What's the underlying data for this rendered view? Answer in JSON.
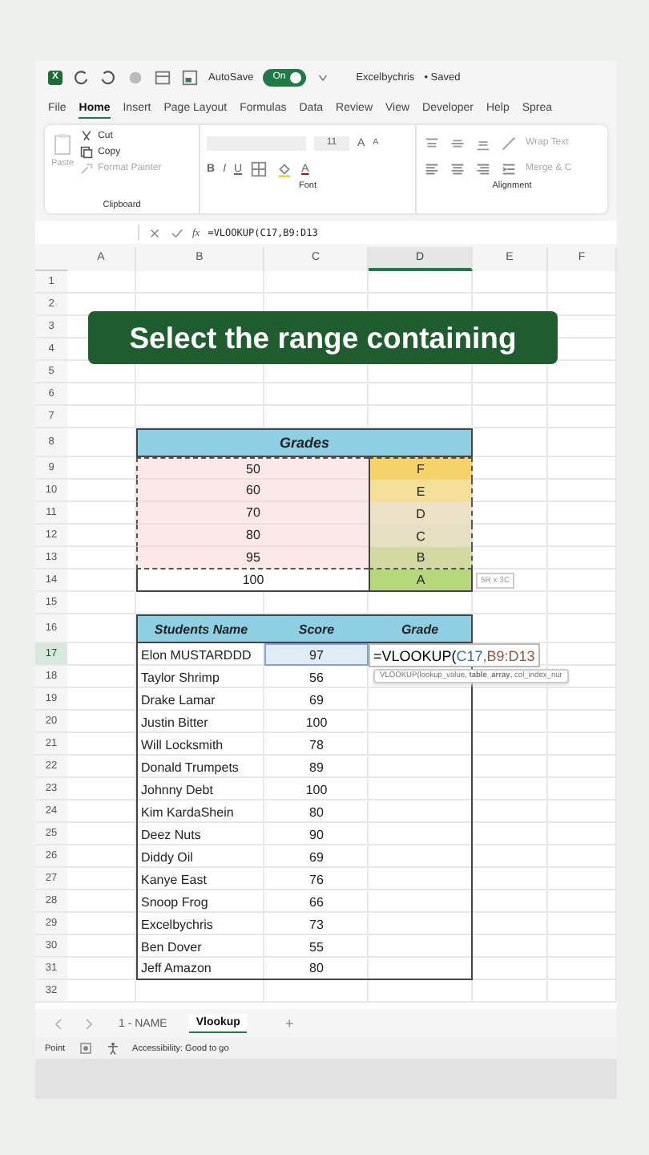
{
  "title_bar": {
    "logo_letter": "X",
    "autosave_label": "AutoSave",
    "autosave_on": true,
    "autosave_state": "On",
    "file_name": "Excelbychris",
    "save_status": "• Saved"
  },
  "menu_tabs": [
    {
      "label": "File",
      "selected": false
    },
    {
      "label": "Home",
      "selected": true
    },
    {
      "label": "Insert",
      "selected": false
    },
    {
      "label": "Page Layout",
      "selected": false
    },
    {
      "label": "Formulas",
      "selected": false
    },
    {
      "label": "Data",
      "selected": false
    },
    {
      "label": "Review",
      "selected": false
    },
    {
      "label": "View",
      "selected": false
    },
    {
      "label": "Developer",
      "selected": false
    },
    {
      "label": "Help",
      "selected": false
    },
    {
      "label": "Sprea",
      "selected": false
    }
  ],
  "ribbon": {
    "clipboard": {
      "paste": "Paste",
      "cut": "Cut",
      "copy": "Copy",
      "format_painter": "Format Painter",
      "group": "Clipboard"
    },
    "font": {
      "size": "11",
      "grow": "A",
      "shrink": "A",
      "bold": "B",
      "italic": "I",
      "underline": "U",
      "font_color_button": "A",
      "group": "Font"
    },
    "alignment": {
      "wrap_text": "Wrap Text",
      "merge": "Merge & C",
      "group": "Alignment"
    }
  },
  "formula_bar": {
    "fx": "fx",
    "formula": "=VLOOKUP(C17,B9:D13"
  },
  "columns": [
    {
      "label": "A",
      "selected": false
    },
    {
      "label": "B",
      "selected": false
    },
    {
      "label": "C",
      "selected": false
    },
    {
      "label": "D",
      "selected": true
    },
    {
      "label": "E",
      "selected": false
    },
    {
      "label": "F",
      "selected": false
    }
  ],
  "banner": "Select the range containing",
  "rows": [
    {
      "number": "1",
      "selected": false,
      "cells": []
    },
    {
      "number": "2",
      "selected": false,
      "cells": []
    },
    {
      "number": "3",
      "selected": false,
      "cells": []
    },
    {
      "number": "4",
      "selected": false,
      "cells": []
    },
    {
      "number": "5",
      "selected": false,
      "cells": []
    },
    {
      "number": "6",
      "selected": false,
      "cells": []
    },
    {
      "number": "7",
      "selected": false,
      "cells": []
    },
    {
      "number": "8",
      "selected": false,
      "cells": [
        {
          "kind": "title",
          "text": "Grades"
        }
      ]
    },
    {
      "number": "9",
      "selected": false,
      "cells": [
        {
          "kind": "range-score",
          "text": "50",
          "in_range": true
        },
        {
          "kind": "grade",
          "text": "F",
          "color": "#f5d36a",
          "in_range": true
        }
      ]
    },
    {
      "number": "10",
      "selected": false,
      "cells": [
        {
          "kind": "range-score",
          "text": "60",
          "in_range": true
        },
        {
          "kind": "grade",
          "text": "E",
          "color": "#f3df98",
          "in_range": true
        }
      ]
    },
    {
      "number": "11",
      "selected": false,
      "cells": [
        {
          "kind": "range-score",
          "text": "70",
          "in_range": true
        },
        {
          "kind": "grade",
          "text": "D",
          "color": "#ece2c8",
          "in_range": true
        }
      ]
    },
    {
      "number": "12",
      "selected": false,
      "cells": [
        {
          "kind": "range-score",
          "text": "80",
          "in_range": true
        },
        {
          "kind": "grade",
          "text": "C",
          "color": "#e6dfc4",
          "in_range": true
        }
      ]
    },
    {
      "number": "13",
      "selected": false,
      "cells": [
        {
          "kind": "range-score",
          "text": "95",
          "in_range": true
        },
        {
          "kind": "grade",
          "text": "B",
          "color": "#d2d9a2",
          "in_range": true
        }
      ]
    },
    {
      "number": "14",
      "selected": false,
      "cells": [
        {
          "kind": "range-score",
          "text": "100",
          "in_range": false
        },
        {
          "kind": "grade",
          "text": "A",
          "color": "#b6d77a",
          "in_range": false,
          "size_tip": "5R x 3C"
        }
      ]
    },
    {
      "number": "15",
      "selected": false,
      "cells": []
    },
    {
      "number": "16",
      "selected": false,
      "cells": [
        {
          "kind": "header",
          "text": "Students Name"
        },
        {
          "kind": "header",
          "text": "Score"
        },
        {
          "kind": "header",
          "text": "Grade"
        }
      ]
    },
    {
      "number": "17",
      "selected": true,
      "cells": [
        {
          "kind": "name",
          "text": "Elon MUSTARDDD"
        },
        {
          "kind": "score",
          "text": "97",
          "referenced": true
        },
        {
          "kind": "formula",
          "parts": [
            {
              "text": "=VLOOKUP("
            },
            {
              "text": "C17",
              "color": "#2f6fb5"
            },
            {
              "text": ",B9:D13",
              "color": "#a0523c"
            }
          ],
          "hint": "VLOOKUP(lookup_value, **table_array**, col_index_nur"
        }
      ]
    },
    {
      "number": "18",
      "selected": false,
      "cells": [
        {
          "kind": "name",
          "text": "Taylor Shrimp"
        },
        {
          "kind": "score",
          "text": "56",
          "referenced": false
        },
        {
          "kind": "blank"
        }
      ]
    },
    {
      "number": "19",
      "selected": false,
      "cells": [
        {
          "kind": "name",
          "text": "Drake Lamar"
        },
        {
          "kind": "score",
          "text": "69",
          "referenced": false
        },
        {
          "kind": "blank"
        }
      ]
    },
    {
      "number": "20",
      "selected": false,
      "cells": [
        {
          "kind": "name",
          "text": "Justin Bitter"
        },
        {
          "kind": "score",
          "text": "100",
          "referenced": false
        },
        {
          "kind": "blank"
        }
      ]
    },
    {
      "number": "21",
      "selected": false,
      "cells": [
        {
          "kind": "name",
          "text": "Will Locksmith"
        },
        {
          "kind": "score",
          "text": "78",
          "referenced": false
        },
        {
          "kind": "blank"
        }
      ]
    },
    {
      "number": "22",
      "selected": false,
      "cells": [
        {
          "kind": "name",
          "text": "Donald Trumpets"
        },
        {
          "kind": "score",
          "text": "89",
          "referenced": false
        },
        {
          "kind": "blank"
        }
      ]
    },
    {
      "number": "23",
      "selected": false,
      "cells": [
        {
          "kind": "name",
          "text": "Johnny Debt"
        },
        {
          "kind": "score",
          "text": "100",
          "referenced": false
        },
        {
          "kind": "blank"
        }
      ]
    },
    {
      "number": "24",
      "selected": false,
      "cells": [
        {
          "kind": "name",
          "text": "Kim KardaShein"
        },
        {
          "kind": "score",
          "text": "80",
          "referenced": false
        },
        {
          "kind": "blank"
        }
      ]
    },
    {
      "number": "25",
      "selected": false,
      "cells": [
        {
          "kind": "name",
          "text": "Deez Nuts"
        },
        {
          "kind": "score",
          "text": "90",
          "referenced": false
        },
        {
          "kind": "blank"
        }
      ]
    },
    {
      "number": "26",
      "selected": false,
      "cells": [
        {
          "kind": "name",
          "text": "Diddy Oil"
        },
        {
          "kind": "score",
          "text": "69",
          "referenced": false
        },
        {
          "kind": "blank"
        }
      ]
    },
    {
      "number": "27",
      "selected": false,
      "cells": [
        {
          "kind": "name",
          "text": "Kanye East"
        },
        {
          "kind": "score",
          "text": "76",
          "referenced": false
        },
        {
          "kind": "blank"
        }
      ]
    },
    {
      "number": "28",
      "selected": false,
      "cells": [
        {
          "kind": "name",
          "text": "Snoop Frog"
        },
        {
          "kind": "score",
          "text": "66",
          "referenced": false
        },
        {
          "kind": "blank"
        }
      ]
    },
    {
      "number": "29",
      "selected": false,
      "cells": [
        {
          "kind": "name",
          "text": "Excelbychris"
        },
        {
          "kind": "score",
          "text": "73",
          "referenced": false
        },
        {
          "kind": "blank"
        }
      ]
    },
    {
      "number": "30",
      "selected": false,
      "cells": [
        {
          "kind": "name",
          "text": "Ben Dover"
        },
        {
          "kind": "score",
          "text": "55",
          "referenced": false
        },
        {
          "kind": "blank"
        }
      ]
    },
    {
      "number": "31",
      "selected": false,
      "cells": [
        {
          "kind": "name",
          "text": "Jeff Amazon"
        },
        {
          "kind": "score",
          "text": "80",
          "referenced": false
        },
        {
          "kind": "blank"
        }
      ]
    },
    {
      "number": "32",
      "selected": false,
      "cells": []
    }
  ],
  "sheet_tabs": [
    {
      "label": "1 - NAME",
      "selected": false
    },
    {
      "label": "Vlookup",
      "selected": true
    }
  ],
  "add_sheet": "+",
  "status_bar": {
    "mode": "Point",
    "accessibility": "Accessibility: Good to go"
  }
}
